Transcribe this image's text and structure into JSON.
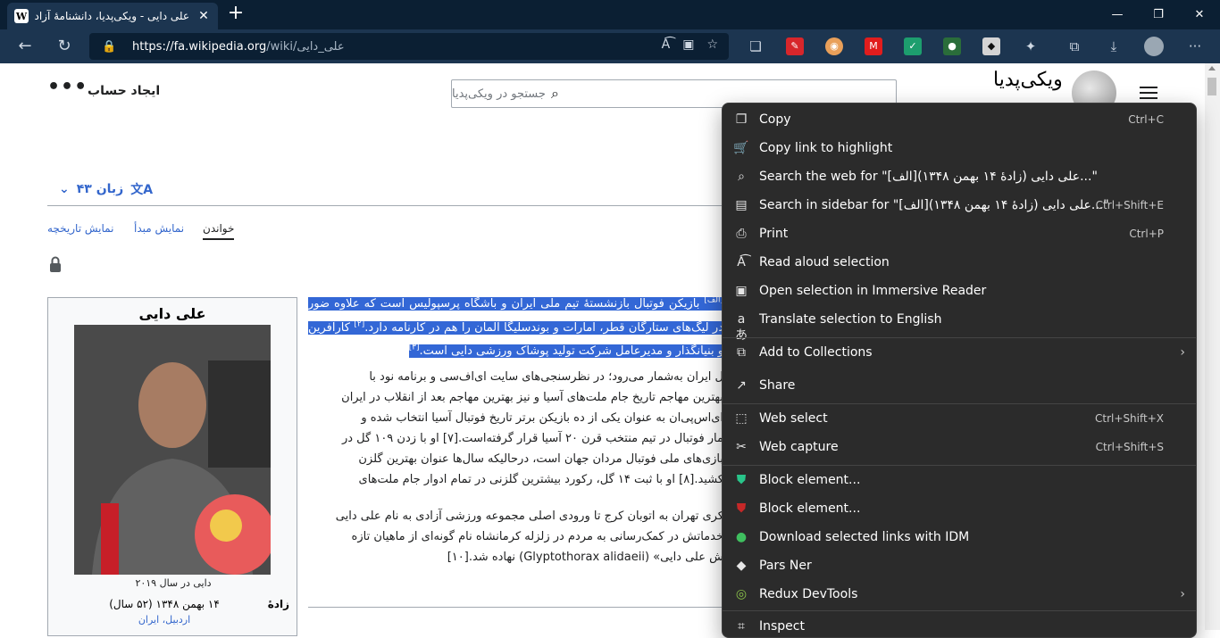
{
  "browser": {
    "tab_title": "علی دایی - ویکی‌پدیا، دانشنامهٔ آزاد",
    "tab_favicon": "W",
    "url_host": "https://fa.wikipedia.org",
    "url_path": "/wiki/علی_دایی",
    "accent": "#1c3550"
  },
  "header": {
    "create_account": "ایجاد حساب",
    "search_placeholder": "جستجو در ویکی‌پدیا",
    "logo_text": "ویکی‌پدیا"
  },
  "page": {
    "languages": "۴۳ زبان",
    "tabs": [
      "خواندن",
      "نمایش مبدأ",
      "نمایش تاریخچه"
    ]
  },
  "infobox": {
    "title": "علی دایی",
    "caption": "دایی در سال ۲۰۱۹",
    "born_label": "زادهٔ",
    "born_value": "۱۴ بهمن ۱۳۴۸ (۵۲ سال)",
    "born_place": "اردبیل، ایران"
  },
  "article": {
    "p1_sel1": "بازیکن فوتبال بازنشستهٔ تیم ملی ایران و باشگاه پرسپولیس است که علاوه",
    "p1_sup1": "[الف]",
    "p1_sel2": "ضور در لیگ‌های ستارگان قطر، امارات و بوندسلیگا آلمان را هم در کارنامه دارد.",
    "p1_sup2": "[۲]",
    "p1_sel3": "کارآفرین و بنیانگذار و مدیرعامل شرکت تولید پوشاک ورزشی دایی است.",
    "p1_sup3": "[۳]",
    "p2": [
      "ل ایران به‌شمار می‌رود؛ در نظرسنجی‌های سایت ای‌اف‌سی و برنامه نود با",
      "بهترین مهاجم تاریخ جام ملت‌های آسیا و نیز بهترین مهاجم بعد از انقلاب در ایران",
      "ای‌اس‌پی‌ان به عنوان یکی از ده بازیکن برتر تاریخ فوتبال آسیا انتخاب شده و",
      "مار فوتبال در تیم منتخب قرن ۲۰ آسیا قرار گرفته‌است.[۷] او با زدن ۱۰۹ گل در",
      "بازی‌های ملی فوتبال مردان جهان است، درحالیکه سال‌ها عنوان بهترین گلزن",
      "کشید.[۸] او با ثبت ۱۴ گل، رکورد بیشترین گلزنی در تمام ادوار جام ملت‌های"
    ],
    "p3": [
      "کری تهران به اتوبان کرج تا ورودی اصلی مجموعه ورزشی آزادی به نام علی دایی",
      "خدماتش در کمک‌رسانی به مردم در زلزله کرمانشاه نام گونه‌ای از ماهیان تازه",
      "ش علی دایی» (Glyptothorax alidaeii) نهاده شد.[۱۰]"
    ]
  },
  "context_menu": {
    "items": [
      {
        "icon": "copy-icon",
        "label": "Copy",
        "shortcut": "Ctrl+C"
      },
      {
        "icon": "link-highlight-icon",
        "label": "Copy link to highlight",
        "shortcut": ""
      },
      {
        "icon": "search-icon",
        "label": "Search the web for \"علی دایی (زادهٔ ۱۴ بهمن ۱۳۴۸)[الف]...\"",
        "shortcut": ""
      },
      {
        "icon": "sidebar-search-icon",
        "label": "Search in sidebar for \"علی دایی (زادهٔ ۱۴ بهمن ۱۳۴۸)[الف]...\"",
        "shortcut": "Ctrl+Shift+E"
      },
      {
        "icon": "print-icon",
        "label": "Print",
        "shortcut": "Ctrl+P"
      },
      {
        "icon": "read-aloud-icon",
        "label": "Read aloud selection",
        "shortcut": ""
      },
      {
        "icon": "immersive-reader-icon",
        "label": "Open selection in Immersive Reader",
        "shortcut": ""
      },
      {
        "icon": "translate-icon",
        "label": "Translate selection to English",
        "shortcut": ""
      },
      {
        "icon": "collections-icon",
        "label": "Add to Collections",
        "shortcut": ""
      },
      {
        "icon": "share-icon",
        "label": "Share",
        "shortcut": ""
      },
      {
        "icon": "web-select-icon",
        "label": "Web select",
        "shortcut": "Ctrl+Shift+X"
      },
      {
        "icon": "web-capture-icon",
        "label": "Web capture",
        "shortcut": "Ctrl+Shift+S"
      },
      {
        "icon": "adguard-icon",
        "label": "Block element...",
        "shortcut": ""
      },
      {
        "icon": "ublock-icon",
        "label": "Block element...",
        "shortcut": ""
      },
      {
        "icon": "idm-icon",
        "label": "Download selected links with IDM",
        "shortcut": ""
      },
      {
        "icon": "parsner-icon",
        "label": "Pars Ner",
        "shortcut": ""
      },
      {
        "icon": "redux-icon",
        "label": "Redux DevTools",
        "shortcut": ""
      },
      {
        "icon": "inspect-icon",
        "label": "Inspect",
        "shortcut": ""
      }
    ]
  }
}
